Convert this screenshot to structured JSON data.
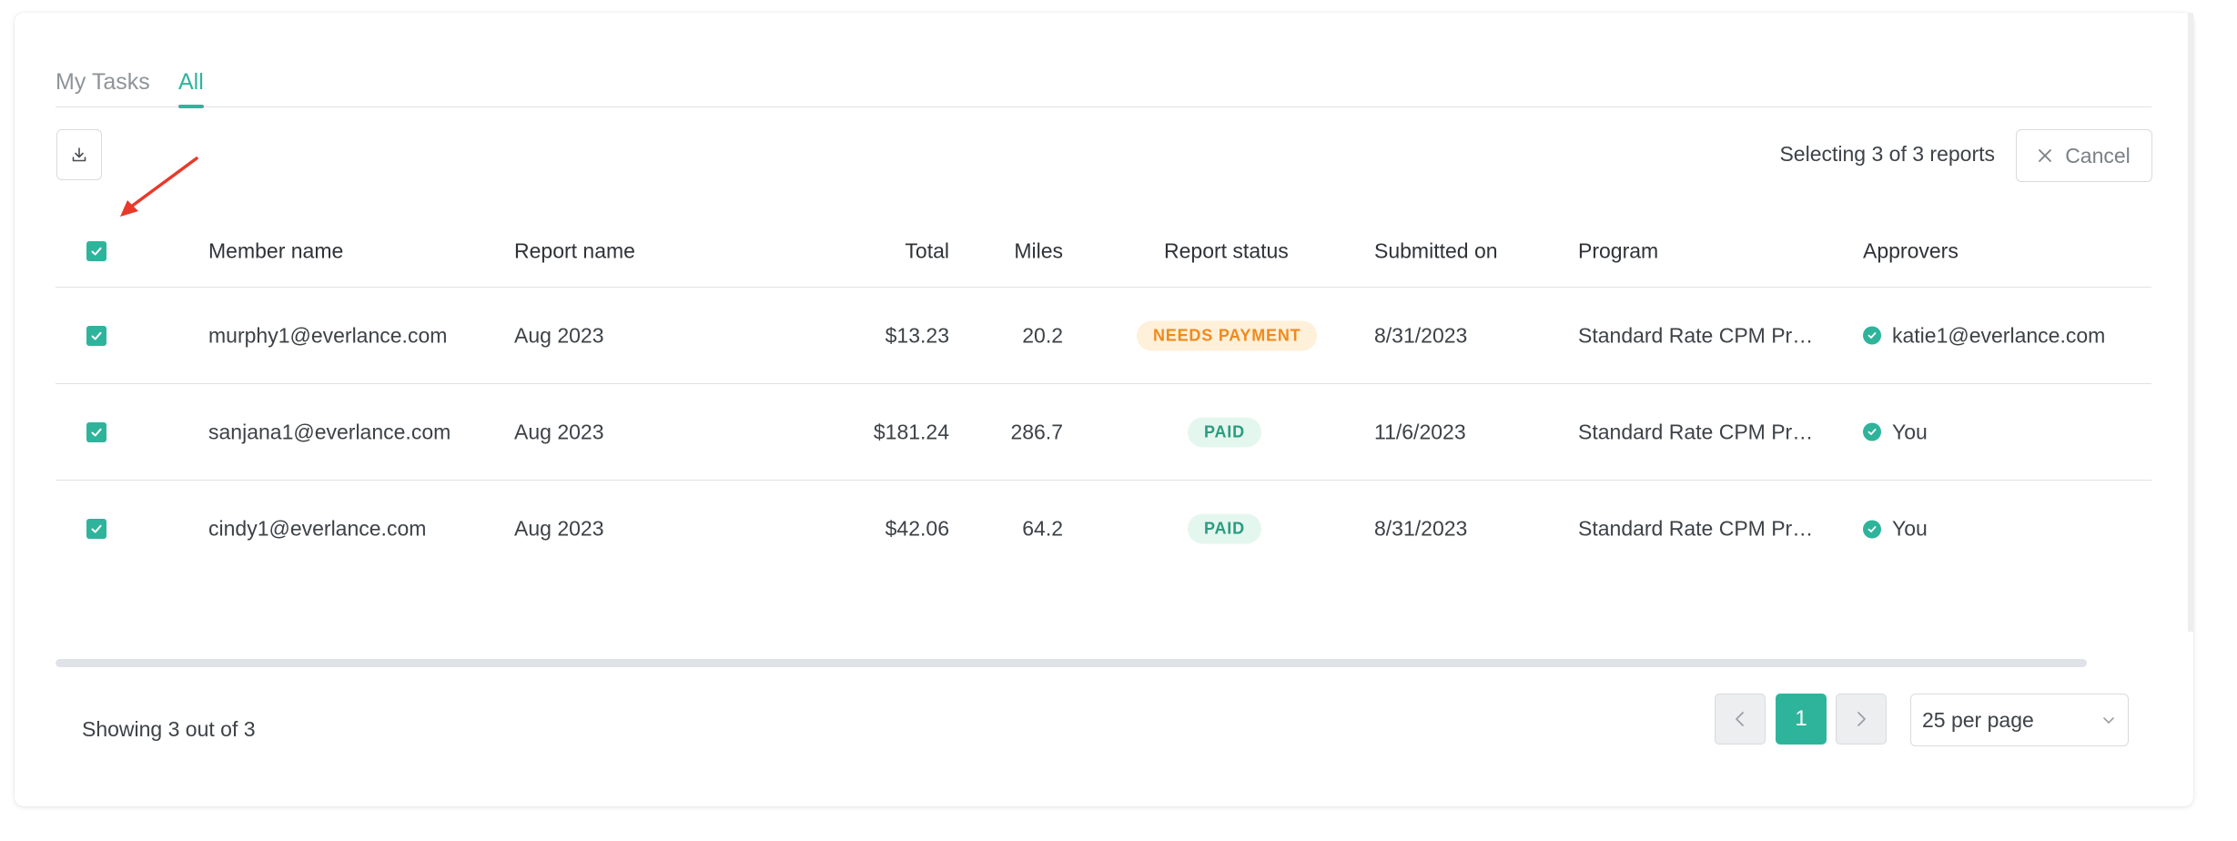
{
  "tabs": [
    {
      "label": "My Tasks",
      "active": false
    },
    {
      "label": "All",
      "active": true
    }
  ],
  "toolbar": {
    "download_icon": "download-icon",
    "selecting_text": "Selecting 3 of 3 reports",
    "cancel_label": "Cancel",
    "cancel_icon": "close-icon"
  },
  "table": {
    "headers": {
      "member": "Member name",
      "report": "Report name",
      "total": "Total",
      "miles": "Miles",
      "status": "Report status",
      "submitted": "Submitted on",
      "program": "Program",
      "approvers": "Approvers"
    },
    "rows": [
      {
        "member": "murphy1@everlance.com",
        "report": "Aug 2023",
        "total": "$13.23",
        "miles": "20.2",
        "status": "NEEDS PAYMENT",
        "submitted": "8/31/2023",
        "program": "Standard Rate CPM Pr…",
        "approver": "katie1@everlance.com"
      },
      {
        "member": "sanjana1@everlance.com",
        "report": "Aug 2023",
        "total": "$181.24",
        "miles": "286.7",
        "status": "PAID",
        "submitted": "11/6/2023",
        "program": "Standard Rate CPM Pr…",
        "approver": "You"
      },
      {
        "member": "cindy1@everlance.com",
        "report": "Aug 2023",
        "total": "$42.06",
        "miles": "64.2",
        "status": "PAID",
        "submitted": "8/31/2023",
        "program": "Standard Rate CPM Pr…",
        "approver": "You"
      }
    ]
  },
  "footer": {
    "showing": "Showing 3 out of 3",
    "current_page": "1",
    "per_page": "25 per page"
  },
  "colors": {
    "accent": "#2fb49c",
    "needs_payment_text": "#f08a1c",
    "needs_payment_bg": "#fff0d9",
    "paid_text": "#2a9d7f",
    "paid_bg": "#e4f7ef",
    "annotation_arrow": "#e8392b"
  }
}
